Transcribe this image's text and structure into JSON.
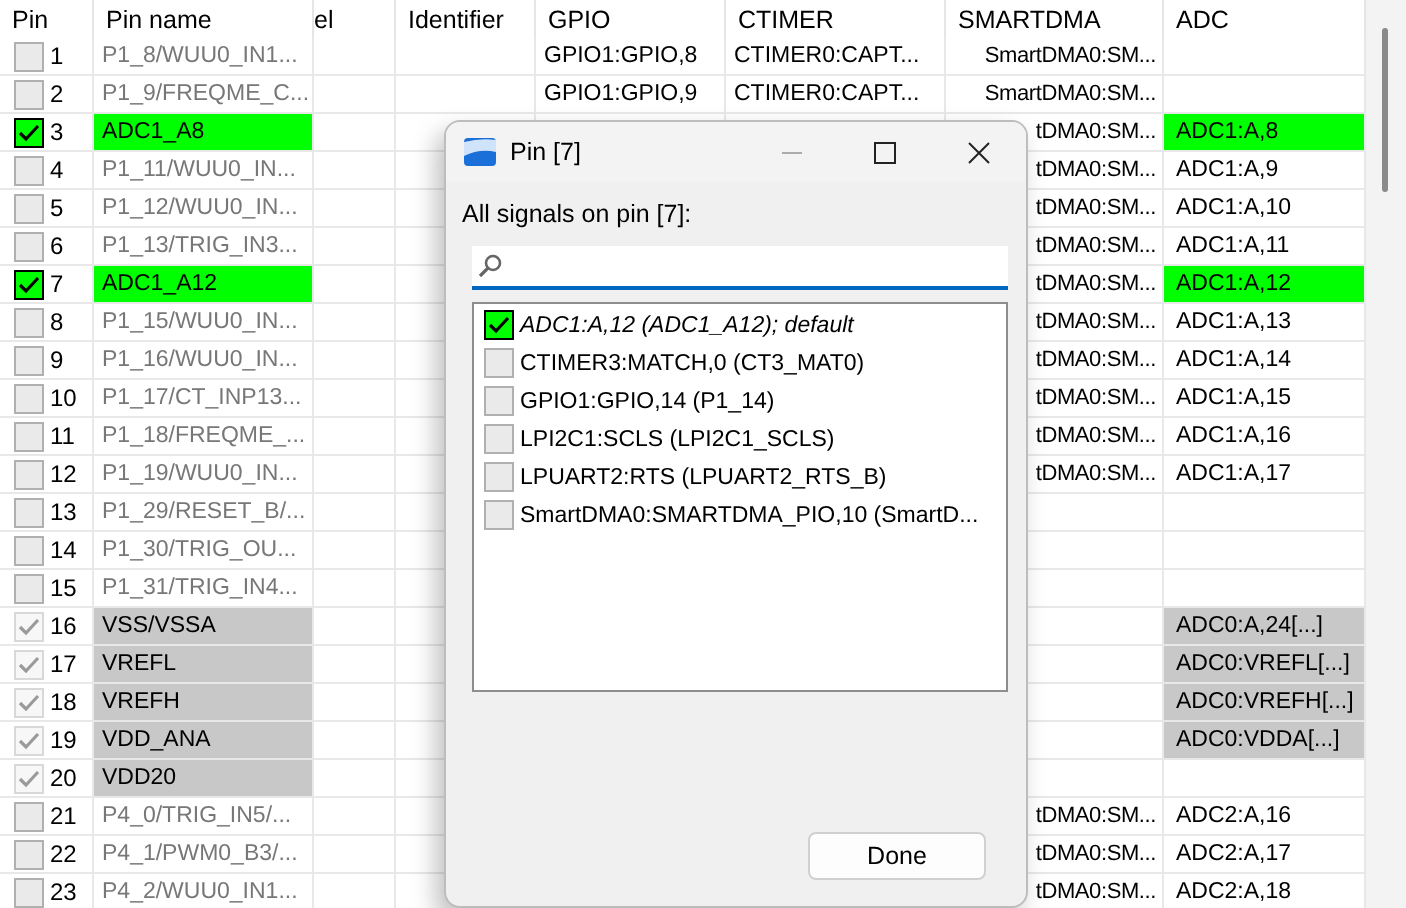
{
  "table": {
    "columns": [
      "Pin",
      "Pin name",
      "el",
      "Identifier",
      "GPIO",
      "CTIMER",
      "SMARTDMA",
      "ADC"
    ],
    "rows": [
      {
        "pin": "1",
        "checked": false,
        "disabled": false,
        "name": "P1_8/WUU0_IN1...",
        "gpio": "GPIO1:GPIO,8",
        "ctimer": "CTIMER0:CAPT...",
        "smartdma": "SmartDMA0:SM..."
      },
      {
        "pin": "2",
        "checked": false,
        "disabled": false,
        "name": "P1_9/FREQME_C...",
        "gpio": "GPIO1:GPIO,9",
        "ctimer": "CTIMER0:CAPT...",
        "smartdma": "SmartDMA0:SM..."
      },
      {
        "pin": "3",
        "checked": true,
        "disabled": false,
        "name": "ADC1_A8",
        "smartdma": "tDMA0:SM...",
        "adc": "ADC1:A,8"
      },
      {
        "pin": "4",
        "checked": false,
        "disabled": false,
        "name": "P1_11/WUU0_IN...",
        "smartdma": "tDMA0:SM...",
        "adc": "ADC1:A,9"
      },
      {
        "pin": "5",
        "checked": false,
        "disabled": false,
        "name": "P1_12/WUU0_IN...",
        "smartdma": "tDMA0:SM...",
        "adc": "ADC1:A,10"
      },
      {
        "pin": "6",
        "checked": false,
        "disabled": false,
        "name": "P1_13/TRIG_IN3...",
        "smartdma": "tDMA0:SM...",
        "adc": "ADC1:A,11"
      },
      {
        "pin": "7",
        "checked": true,
        "disabled": false,
        "name": "ADC1_A12",
        "smartdma": "tDMA0:SM...",
        "adc": "ADC1:A,12"
      },
      {
        "pin": "8",
        "checked": false,
        "disabled": false,
        "name": "P1_15/WUU0_IN...",
        "smartdma": "tDMA0:SM...",
        "adc": "ADC1:A,13"
      },
      {
        "pin": "9",
        "checked": false,
        "disabled": false,
        "name": "P1_16/WUU0_IN...",
        "smartdma": "tDMA0:SM...",
        "adc": "ADC1:A,14"
      },
      {
        "pin": "10",
        "checked": false,
        "disabled": false,
        "name": "P1_17/CT_INP13...",
        "smartdma": "tDMA0:SM...",
        "adc": "ADC1:A,15"
      },
      {
        "pin": "11",
        "checked": false,
        "disabled": false,
        "name": "P1_18/FREQME_...",
        "smartdma": "tDMA0:SM...",
        "adc": "ADC1:A,16"
      },
      {
        "pin": "12",
        "checked": false,
        "disabled": false,
        "name": "P1_19/WUU0_IN...",
        "smartdma": "tDMA0:SM...",
        "adc": "ADC1:A,17"
      },
      {
        "pin": "13",
        "checked": false,
        "disabled": false,
        "name": "P1_29/RESET_B/..."
      },
      {
        "pin": "14",
        "checked": false,
        "disabled": false,
        "name": "P1_30/TRIG_OU..."
      },
      {
        "pin": "15",
        "checked": false,
        "disabled": false,
        "name": "P1_31/TRIG_IN4..."
      },
      {
        "pin": "16",
        "checked": true,
        "disabled": true,
        "name": "VSS/VSSA",
        "adc": "ADC0:A,24[...]"
      },
      {
        "pin": "17",
        "checked": true,
        "disabled": true,
        "name": "VREFL",
        "adc": "ADC0:VREFL[...]"
      },
      {
        "pin": "18",
        "checked": true,
        "disabled": true,
        "name": "VREFH",
        "adc": "ADC0:VREFH[...]"
      },
      {
        "pin": "19",
        "checked": true,
        "disabled": true,
        "name": "VDD_ANA",
        "adc": "ADC0:VDDA[...]"
      },
      {
        "pin": "20",
        "checked": true,
        "disabled": true,
        "name": "VDD20"
      },
      {
        "pin": "21",
        "checked": false,
        "disabled": false,
        "name": "P4_0/TRIG_IN5/...",
        "smartdma": "tDMA0:SM...",
        "adc": "ADC2:A,16"
      },
      {
        "pin": "22",
        "checked": false,
        "disabled": false,
        "name": "P4_1/PWM0_B3/...",
        "smartdma": "tDMA0:SM...",
        "adc": "ADC2:A,17"
      },
      {
        "pin": "23",
        "checked": false,
        "disabled": false,
        "name": "P4_2/WUU0_IN1...",
        "smartdma": "tDMA0:SM...",
        "adc": "ADC2:A,18"
      }
    ]
  },
  "dialog": {
    "title": "Pin [7]",
    "label": "All signals on pin [7]:",
    "signals": [
      {
        "text": "ADC1:A,12 (ADC1_A12); default",
        "checked": true
      },
      {
        "text": "CTIMER3:MATCH,0 (CT3_MAT0)",
        "checked": false
      },
      {
        "text": "GPIO1:GPIO,14 (P1_14)",
        "checked": false
      },
      {
        "text": "LPI2C1:SCLS (LPI2C1_SCLS)",
        "checked": false
      },
      {
        "text": "LPUART2:RTS (LPUART2_RTS_B)",
        "checked": false
      },
      {
        "text": "SmartDMA0:SMARTDMA_PIO,10 (SmartD...",
        "checked": false
      }
    ],
    "button": "Done"
  }
}
